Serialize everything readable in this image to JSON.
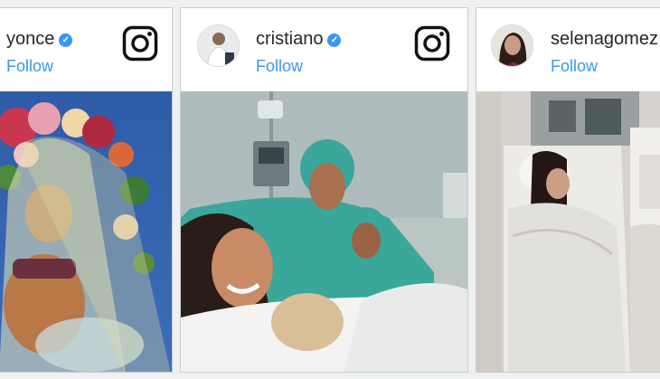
{
  "cards": [
    {
      "username": "beyonce",
      "username_visible": "yonce",
      "follow_label": "Follow",
      "verified": true,
      "logo_icon": "instagram-icon"
    },
    {
      "username": "cristiano",
      "username_visible": "cristiano",
      "follow_label": "Follow",
      "verified": true,
      "logo_icon": "instagram-icon"
    },
    {
      "username": "selenagomez",
      "username_visible": "selenagomez",
      "follow_label": "Follow",
      "verified": false,
      "logo_icon": "instagram-icon"
    }
  ],
  "colors": {
    "follow_blue": "#3897f0",
    "verified_blue": "#3897f0",
    "username_text": "#262626",
    "card_border": "#c9cccf"
  }
}
